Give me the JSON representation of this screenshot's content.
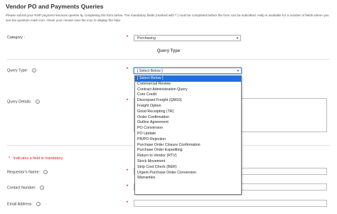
{
  "page": {
    "title": "Vendor PO and Payments Queries",
    "intro_part1": "Please submit your RHP payment services queries by completing the form below. The mandatory fields (marked with",
    "intro_star": "*",
    "intro_part2": ") must be completed before the form can be submitted. Help is available for a number of fields where you see the question mark icon. Hover your mouse over the icon to display the help."
  },
  "form": {
    "category_label": "Category :",
    "category_value": "Purchasing",
    "query_type_section": "Query Type",
    "query_type_label": "Query Type:",
    "query_type_value": "[ Select Below ]",
    "query_details_label": "Query Details:",
    "mandatory_note": "Indicates a field is mandatory",
    "requestor_label": "Requestor's Name:",
    "contact_label": "Contact Number:",
    "email_label": "Email Address:",
    "star": "*",
    "help_glyph": "?",
    "caret_glyph": "▾"
  },
  "dropdown": {
    "options": [
      "[ Select Below ]",
      "Commercial Review",
      "Contract Administration Query",
      "Core Credit",
      "Discrepant Freight (QM10)",
      "Freight Option",
      "Good Receipting (TR)",
      "Order Confirmation",
      "Outline Agreement",
      "PO Conversion",
      "PO Update",
      "PR/PO Rejection",
      "Purchase Order Closure Confirmation",
      "Purchase Order Expediting",
      "Return to Vendor (RTV)",
      "Stock Movement",
      "Strip Cost Check (BER)",
      "Urgent Purchase Order Conversion",
      "Warranties"
    ],
    "selected_index": 0
  },
  "colors": {
    "mandatory": "#d9241e",
    "selection": "#1e6fd9"
  }
}
